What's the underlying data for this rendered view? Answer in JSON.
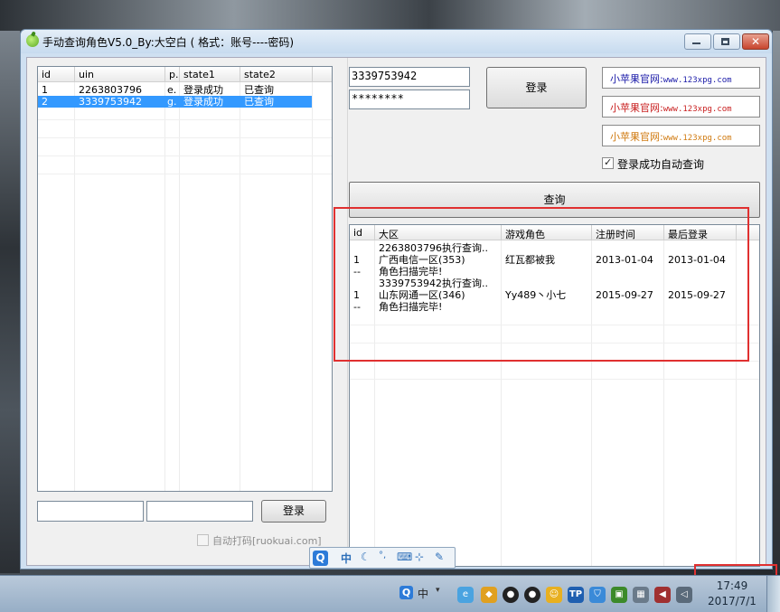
{
  "window": {
    "title": "手动查询角色V5.0_By:大空白 ( 格式：账号----密码)"
  },
  "accounts_table": {
    "headers": [
      "id",
      "uin",
      "p.",
      "state1",
      "state2"
    ],
    "rows": [
      {
        "id": "1",
        "uin": "2263803796",
        "p": "e.",
        "state1": "登录成功",
        "state2": "已查询",
        "selected": false
      },
      {
        "id": "2",
        "uin": "3339753942",
        "p": "g.",
        "state1": "登录成功",
        "state2": "已查询",
        "selected": true
      }
    ]
  },
  "bottom_left": {
    "login_button": "登录",
    "auto_captcha_label": "自动打码[ruokuai.com]",
    "auto_captcha_checked": false
  },
  "login_form": {
    "account_value": "3339753942",
    "password_value": "********",
    "login_button": "登录"
  },
  "site_links": [
    {
      "prefix": "小苹果官网:",
      "url": "www.123xpg.com",
      "color": "#1a1aa8"
    },
    {
      "prefix": "小苹果官网:",
      "url": "www.123xpg.com",
      "color": "#c81e1e"
    },
    {
      "prefix": "小苹果官网:",
      "url": "www.123xpg.com",
      "color": "#d07a10"
    }
  ],
  "auto_query": {
    "label": "登录成功自动查询",
    "checked": true
  },
  "query_button": "查询",
  "roles_table": {
    "headers": [
      "id",
      "大区",
      "游戏角色",
      "注册时间",
      "最后登录"
    ],
    "rows": [
      {
        "id": "",
        "area": "2263803796执行查询..",
        "role": "",
        "reg": "",
        "last": ""
      },
      {
        "id": "1",
        "area": "广西电信一区(353)",
        "role": "红瓦都被我",
        "reg": "2013-01-04",
        "last": "2013-01-04"
      },
      {
        "id": "--",
        "area": "角色扫描完毕!",
        "role": "",
        "reg": "",
        "last": ""
      },
      {
        "id": "",
        "area": "3339753942执行查询..",
        "role": "",
        "reg": "",
        "last": ""
      },
      {
        "id": "1",
        "area": "山东网通一区(346)",
        "role": "Yy489丶小七",
        "reg": "2015-09-27",
        "last": "2015-09-27"
      },
      {
        "id": "--",
        "area": "角色扫描完毕!",
        "role": "",
        "reg": "",
        "last": ""
      }
    ]
  },
  "ime_bar": {
    "logo": "Q",
    "mode": "中"
  },
  "taskbar": {
    "ime_mode": "中",
    "time": "17:49",
    "date": "2017/7/1"
  },
  "highlight_color": "#e03030"
}
